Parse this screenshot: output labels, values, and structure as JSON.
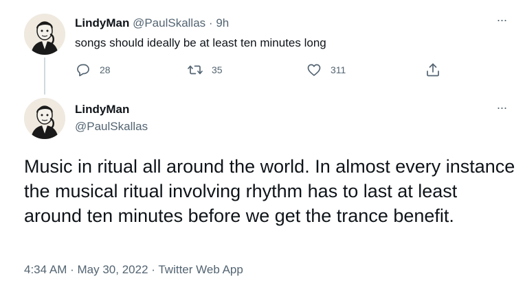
{
  "parent_tweet": {
    "display_name": "LindyMan",
    "handle": "@PaulSkallas",
    "separator": "·",
    "time": "9h",
    "text": "songs should ideally be at least ten minutes long",
    "more_label": "···",
    "actions": {
      "replies": "28",
      "retweets": "35",
      "likes": "311"
    },
    "avatar_icon": "user-avatar-icon"
  },
  "main_tweet": {
    "display_name": "LindyMan",
    "handle": "@PaulSkallas",
    "more_label": "···",
    "text": "Music in ritual all around the world. In almost every instance the musical ritual involving rhythm has to last at least around ten minutes before we get the trance benefit.",
    "timestamp": "4:34 AM",
    "separator": "·",
    "date": "May 30, 2022",
    "source": "Twitter Web App",
    "avatar_icon": "user-avatar-icon"
  },
  "colors": {
    "text": "#0f1419",
    "secondary": "#536471",
    "thread_line": "#cfd9de"
  }
}
